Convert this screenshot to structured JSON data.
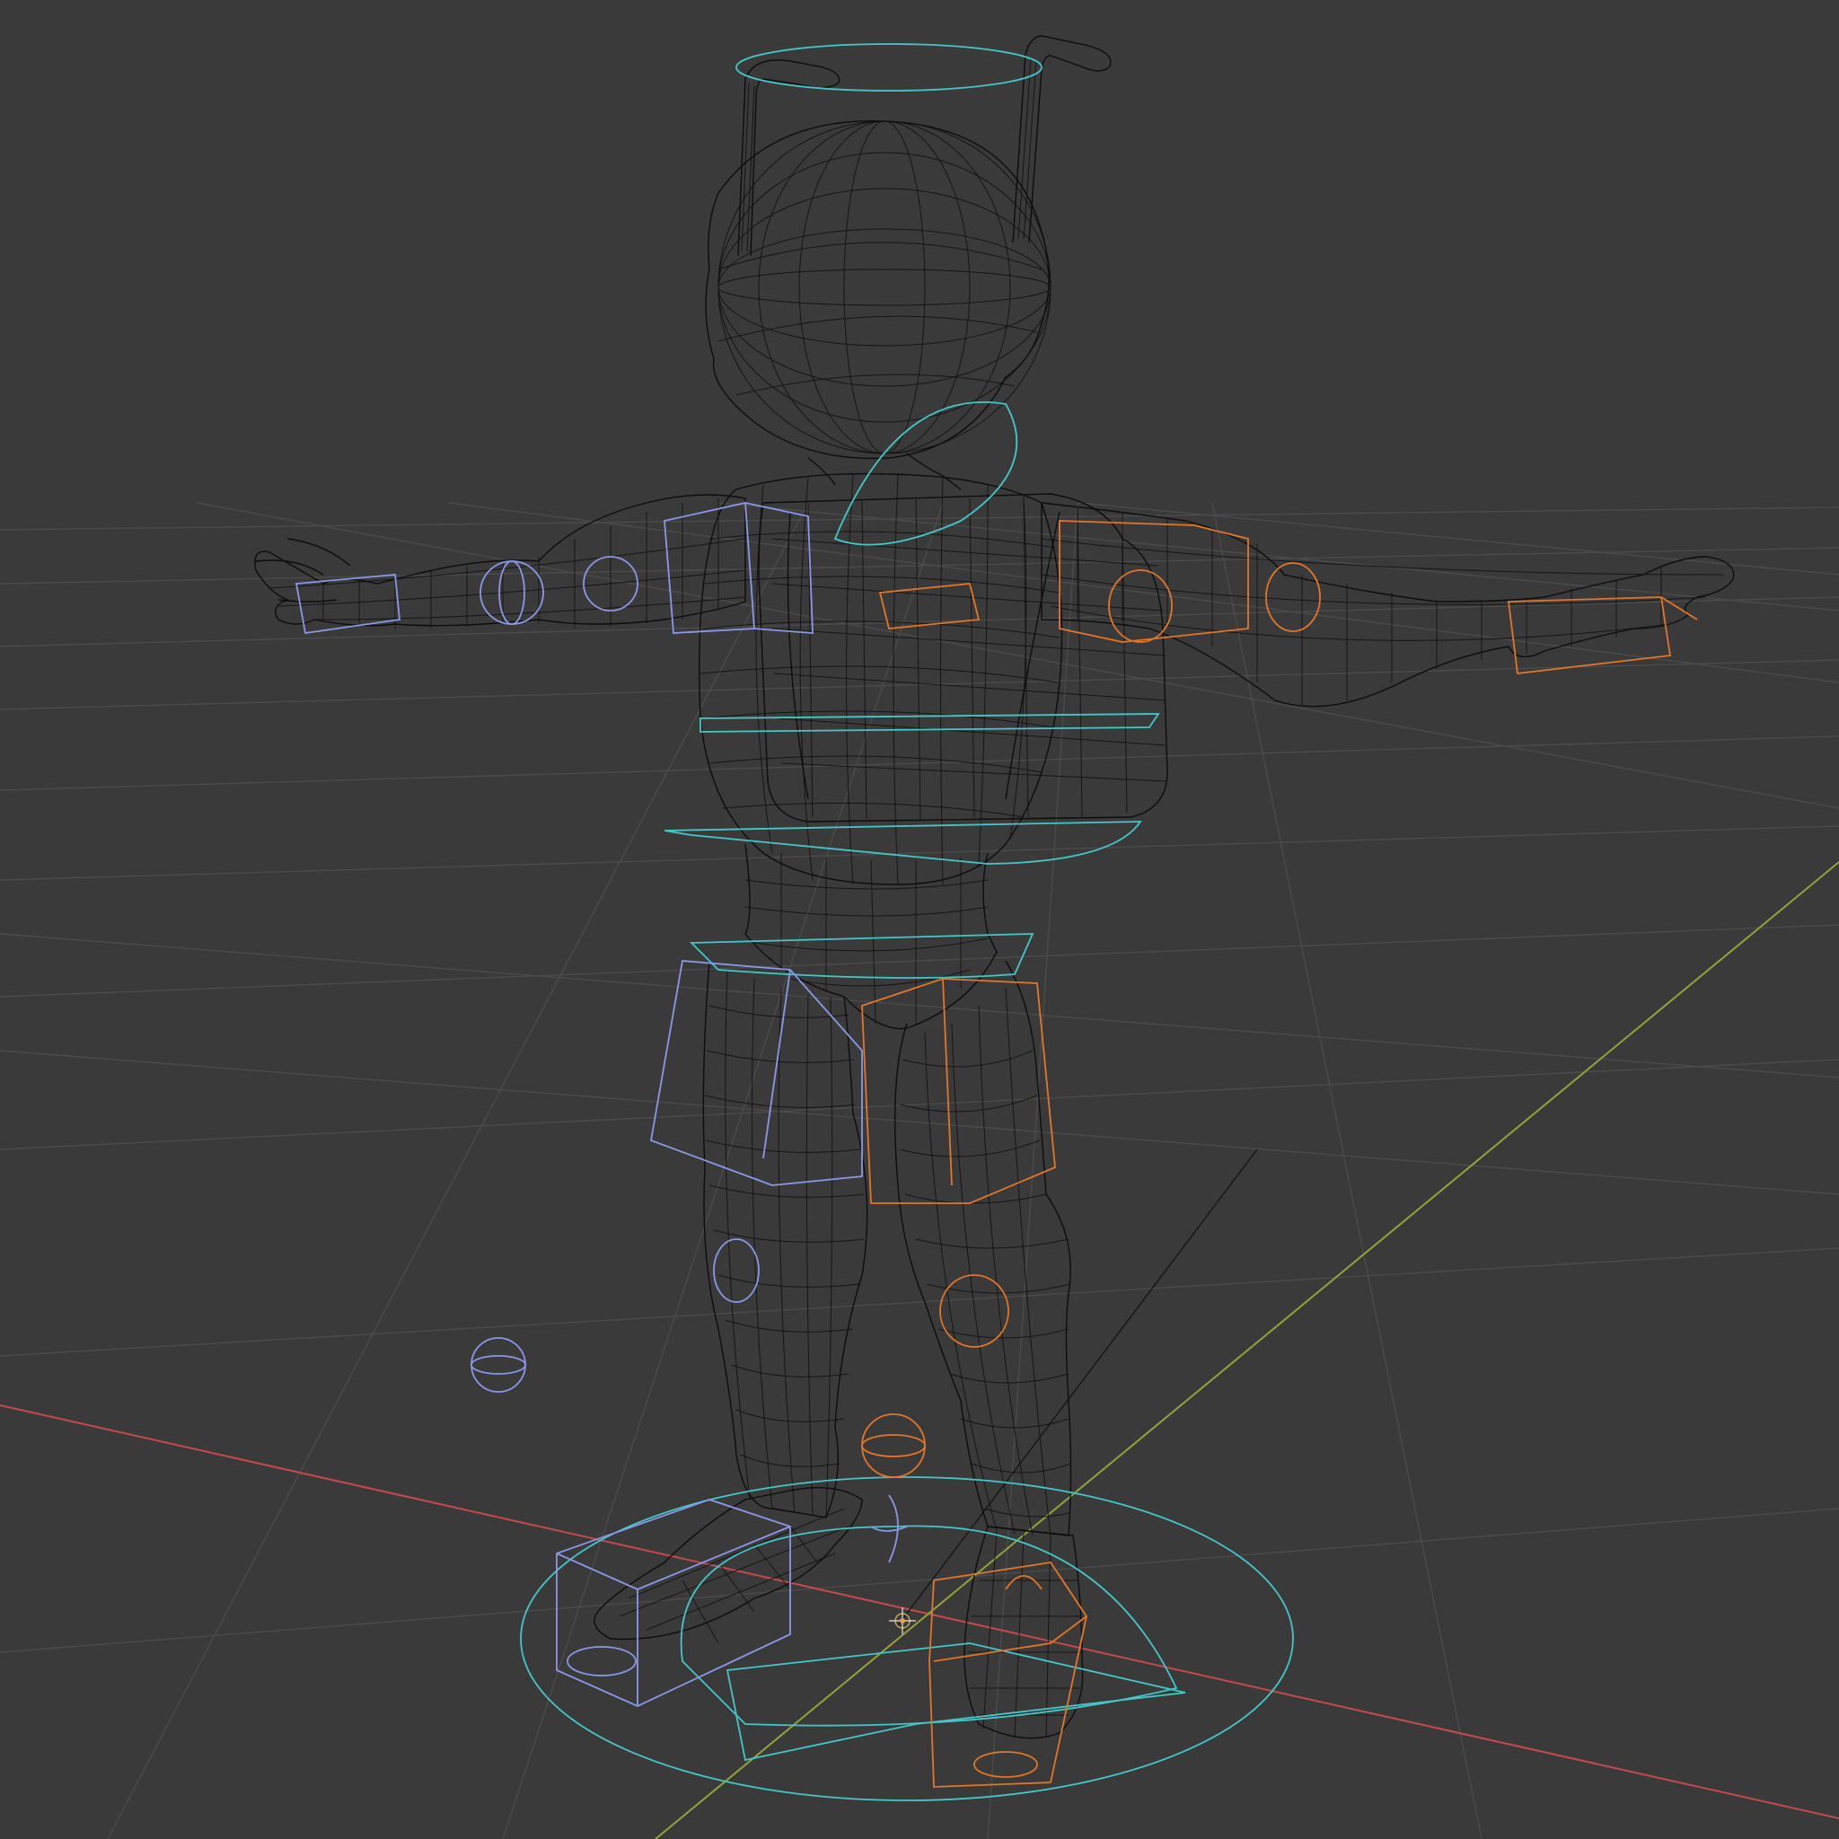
{
  "viewport": {
    "mode": "wireframe",
    "shading": "wireframe",
    "colors": {
      "background": "#3a3a3a",
      "grid": "#4b4b4b",
      "mesh_wire": "#0d0d0d",
      "x_axis": "#c54a4f",
      "y_axis": "#8fa43a",
      "control_center": "#45c7c9",
      "control_left": "#8c97e6",
      "control_right": "#e2762a"
    }
  },
  "scene": {
    "object": "character-mesh",
    "rig": "armature-controls",
    "pose": "T-pose",
    "icons": [
      "3d-cursor-icon",
      "origin-icon"
    ]
  }
}
